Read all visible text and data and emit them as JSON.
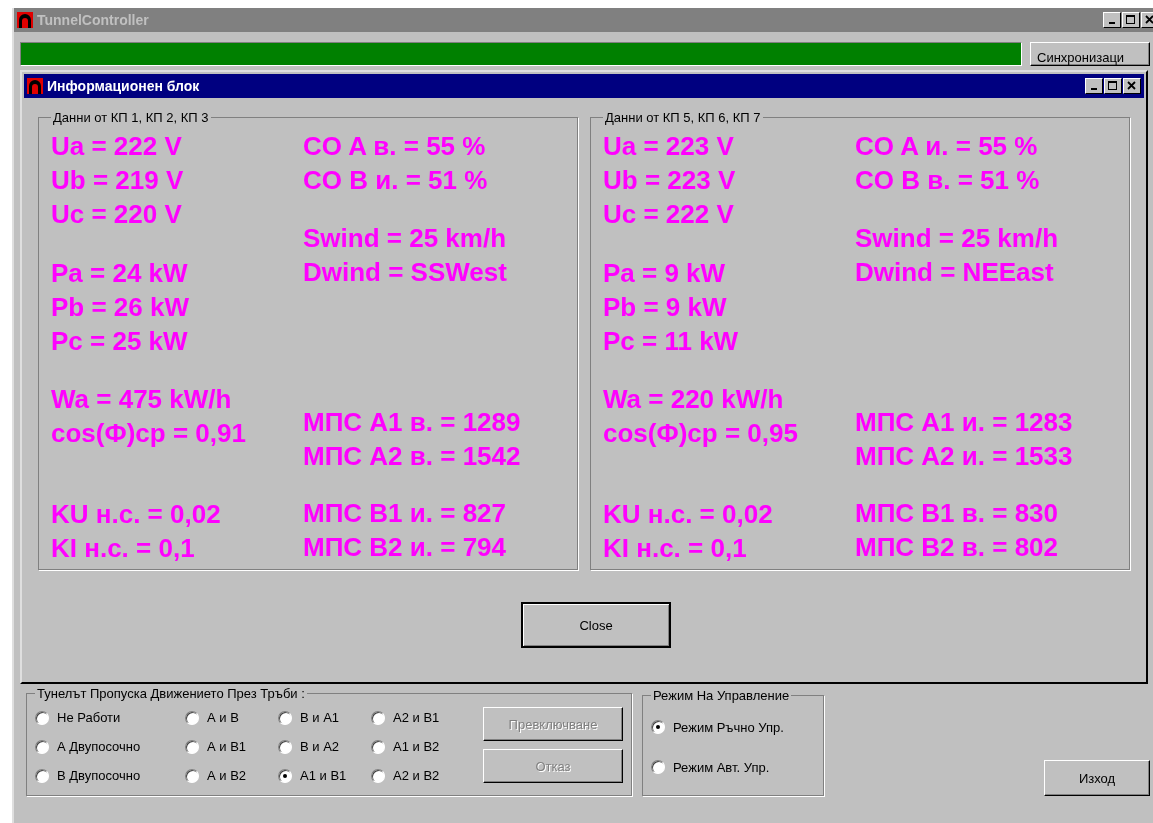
{
  "window": {
    "title": "TunnelController"
  },
  "progress": {
    "level": 1
  },
  "sync_button": {
    "label": "Синхронизаци"
  },
  "dialog": {
    "title": "Информационен блок",
    "groups": [
      {
        "title": "Данни от КП 1, КП 2, КП 3",
        "left": [
          "Ua = 222 V",
          "Ub = 219 V",
          "Uc = 220 V",
          "Pa = 24 kW",
          "Pb = 26 kW",
          "Pc = 25 kW",
          "Wa = 475 kW/h",
          "cos(Ф)ср = 0,91",
          "KU н.с. = 0,02",
          "KI н.с. = 0,1"
        ],
        "right": [
          "CO A в. = 55 %",
          "CO B и. = 51 %",
          "Swind = 25 km/h",
          "Dwind = SSWest",
          "МПС A1 в. = 1289",
          "МПС A2 в. = 1542",
          "МПС B1 и. = 827",
          "МПС B2 и. = 794"
        ]
      },
      {
        "title": "Данни от КП 5, КП 6, КП 7",
        "left": [
          "Ua = 223 V",
          "Ub = 223 V",
          "Uc = 222 V",
          "Pa = 9 kW",
          "Pb = 9 kW",
          "Pc = 11 kW",
          "Wa = 220 kW/h",
          "cos(Ф)ср = 0,95",
          "KU н.с. = 0,02",
          "KI н.с. = 0,1"
        ],
        "right": [
          "CO A и. = 55 %",
          "CO B в. = 51 %",
          "Swind = 25 km/h",
          "Dwind = NEEast",
          "МПС A1 и. = 1283",
          "МПС A2 и. = 1533",
          "МПС B1 в. = 830",
          "МПС B2 в. = 802"
        ]
      }
    ],
    "close_button": "Close"
  },
  "pipes": {
    "title": "Тунелът Пропуска Движението През Тръби :",
    "options": [
      {
        "label": "Не Работи",
        "selected": false
      },
      {
        "label": "А Двупосочно",
        "selected": false
      },
      {
        "label": "В Двупосочно",
        "selected": false
      },
      {
        "label": "А и В",
        "selected": false
      },
      {
        "label": "А и В1",
        "selected": false
      },
      {
        "label": "А и В2",
        "selected": false
      },
      {
        "label": "В и А1",
        "selected": false
      },
      {
        "label": "В и А2",
        "selected": false
      },
      {
        "label": "А1 и В1",
        "selected": true
      },
      {
        "label": "А2 и В1",
        "selected": false
      },
      {
        "label": "А1 и В2",
        "selected": false
      },
      {
        "label": "А2 и В2",
        "selected": false
      }
    ],
    "buttons": [
      {
        "label": "Превключване",
        "disabled": true
      },
      {
        "label": "Отказ",
        "disabled": true
      }
    ]
  },
  "mode": {
    "title": "Режим На Управление",
    "options": [
      {
        "label": "Режим Ръчно Упр.",
        "selected": true
      },
      {
        "label": "Режим Авт. Упр.",
        "selected": false
      }
    ]
  },
  "exit_button": "Изход"
}
